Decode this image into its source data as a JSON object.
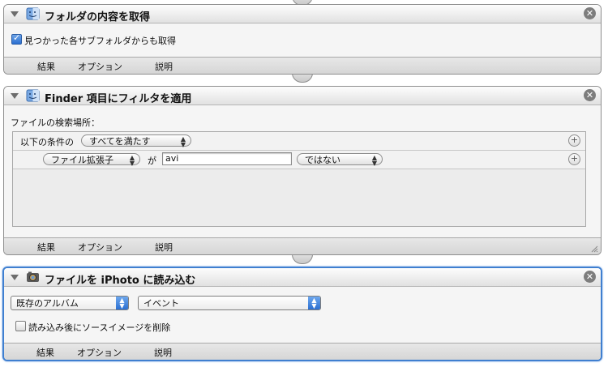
{
  "actions": [
    {
      "title": "フォルダの内容を取得",
      "checkbox_label": "見つかった各サブフォルダからも取得",
      "checkbox_checked": true,
      "footer": [
        "結果",
        "オプション",
        "説明"
      ]
    },
    {
      "title": "Finder 項目にフィルタを適用",
      "search_location_label": "ファイルの検索場所：",
      "condition_prefix": "以下の条件の",
      "condition_popup": "すべてを満たす",
      "rule": {
        "field_popup": "ファイル拡張子",
        "ga_label": "が",
        "value": "avi",
        "operator_popup": "ではない"
      },
      "footer": [
        "結果",
        "オプション",
        "説明"
      ]
    },
    {
      "title": "ファイルを iPhoto に読み込む",
      "album_popup": "既存のアルバム",
      "event_popup": "イベント",
      "delete_label": "読み込み後にソースイメージを削除",
      "delete_checked": false,
      "footer": [
        "結果",
        "オプション",
        "説明"
      ]
    }
  ],
  "colors": {
    "selection_border": "#3f7fd0",
    "popup_blue": "#2b6fd1",
    "close_button": "#7d7d7d"
  },
  "icons": {
    "finder_action_icon": "finder-icon",
    "iphoto_action_icon": "iphoto-icon",
    "close": "close-icon",
    "disclosure": "disclosure-triangle-icon"
  }
}
